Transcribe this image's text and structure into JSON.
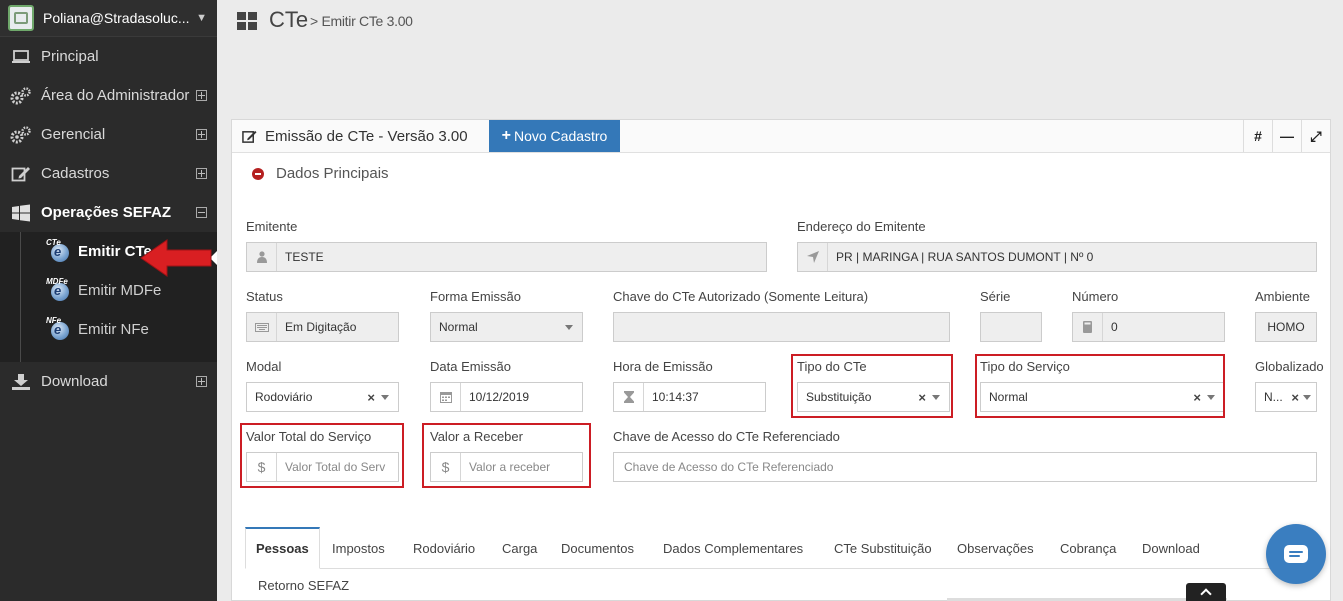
{
  "user": {
    "name": "Poliana@Stradasoluc..."
  },
  "sidebar": {
    "items": [
      {
        "label": "Principal",
        "icon": "laptop-icon"
      },
      {
        "label": "Área do Administrador",
        "icon": "gears-icon"
      },
      {
        "label": "Gerencial",
        "icon": "gears-icon"
      },
      {
        "label": "Cadastros",
        "icon": "edit-icon"
      },
      {
        "label": "Operações SEFAZ",
        "icon": "windows-icon"
      },
      {
        "label": "Download",
        "icon": "download-icon"
      }
    ],
    "sub_items": [
      {
        "label": "Emitir CTe",
        "badge": "CTe"
      },
      {
        "label": "Emitir MDFe",
        "badge": "MDFe"
      },
      {
        "label": "Emitir NFe",
        "badge": "NFe"
      }
    ]
  },
  "header": {
    "title": "CTe",
    "breadcrumb": "> Emitir CTe 3.00"
  },
  "panel": {
    "title": "Emissão de CTe - Versão 3.00",
    "new_button": "Novo Cadastro",
    "tools": [
      "#",
      "—",
      "⤢"
    ],
    "section": "Dados Principais"
  },
  "form": {
    "emitente": {
      "label": "Emitente",
      "value": "TESTE"
    },
    "endereco": {
      "label": "Endereço do Emitente",
      "value": "PR | MARINGA | RUA SANTOS DUMONT | Nº 0"
    },
    "status": {
      "label": "Status",
      "value": "Em Digitação"
    },
    "forma_emissao": {
      "label": "Forma Emissão",
      "value": "Normal"
    },
    "chave_autorizado": {
      "label": "Chave do CTe Autorizado (Somente Leitura)",
      "value": ""
    },
    "serie": {
      "label": "Série",
      "value": ""
    },
    "numero": {
      "label": "Número",
      "value": "0"
    },
    "ambiente": {
      "label": "Ambiente",
      "value": "HOMO"
    },
    "modal": {
      "label": "Modal",
      "value": "Rodoviário"
    },
    "data_emissao": {
      "label": "Data Emissão",
      "value": "10/12/2019"
    },
    "hora_emissao": {
      "label": "Hora de Emissão",
      "value": "10:14:37"
    },
    "tipo_cte": {
      "label": "Tipo do CTe",
      "value": "Substituição"
    },
    "tipo_servico": {
      "label": "Tipo do Serviço",
      "value": "Normal"
    },
    "globalizado": {
      "label": "Globalizado",
      "value": "N..."
    },
    "valor_total": {
      "label": "Valor Total do Serviço",
      "placeholder": "Valor Total do Serv"
    },
    "valor_receber": {
      "label": "Valor a Receber",
      "placeholder": "Valor a receber"
    },
    "chave_referenciado": {
      "label": "Chave de Acesso do CTe Referenciado",
      "placeholder": "Chave de Acesso do CTe Referenciado"
    }
  },
  "tabs": [
    "Pessoas",
    "Impostos",
    "Rodoviário",
    "Carga",
    "Documentos",
    "Dados Complementares",
    "CTe Substituição",
    "Observações",
    "Cobrança",
    "Download"
  ],
  "retorno": "Retorno SEFAZ",
  "colors": {
    "accent": "#3478b8",
    "highlight": "#cc1d24",
    "sidebar": "#2b2b2b"
  }
}
